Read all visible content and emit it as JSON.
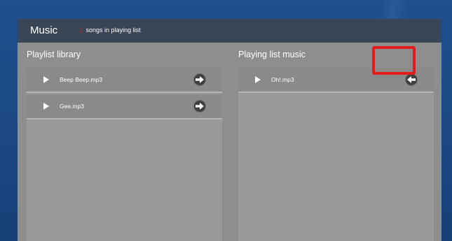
{
  "header": {
    "title": "Music",
    "count": "1",
    "count_suffix": "songs in playing list",
    "count_color": "#e0191b"
  },
  "playlist_library": {
    "title": "Playlist library",
    "items": [
      {
        "name": "Beep Beep.mp3",
        "action_icon": "arrow-right-icon"
      },
      {
        "name": "Gee.mp3",
        "action_icon": "arrow-right-icon"
      }
    ]
  },
  "playing_list": {
    "title": "Playing list music",
    "items": [
      {
        "name": "Oh!.mp3",
        "action_icon": "arrow-left-icon",
        "highlighted": true
      }
    ]
  },
  "colors": {
    "background": "#1f4f8e",
    "header_bar": "#3a4656",
    "panel": "#999999",
    "highlight": "#e31b1b"
  }
}
